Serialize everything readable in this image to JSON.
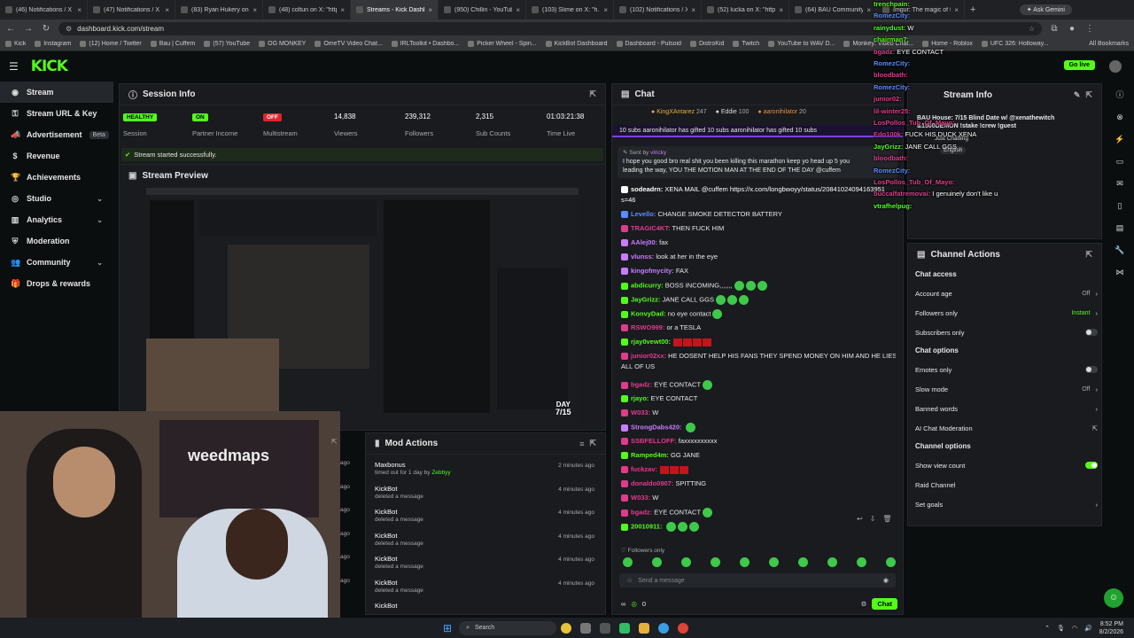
{
  "browser": {
    "tabs": [
      {
        "title": "(46) Notifications / X",
        "active": false
      },
      {
        "title": "(47) Notifications / X",
        "active": false
      },
      {
        "title": "(83) Ryan Hukery on X",
        "active": false
      },
      {
        "title": "(48) coltun on X: \"http...",
        "active": false
      },
      {
        "title": "Streams - Kick Dashboa...",
        "active": true
      },
      {
        "title": "(950) Chillin - YouTube",
        "active": false
      },
      {
        "title": "(103) Slime on X: \"h...",
        "active": false
      },
      {
        "title": "(102) Notifications / X",
        "active": false
      },
      {
        "title": "(52) lucka on X: \"http...",
        "active": false
      },
      {
        "title": "(64) BAU Community",
        "active": false
      },
      {
        "title": "Imgur: The magic of th...",
        "active": false
      }
    ],
    "ask_gemini": "Ask Gemini",
    "url": "dashboard.kick.com/stream",
    "bookmarks": [
      "Kick",
      "Instagram",
      "(12) Home / Twitter",
      "Bau | Cuffem",
      "(57) YouTube",
      "OG MONKEY",
      "OmeTV Video Chat...",
      "IRLToolkit • Dashbo...",
      "Picker Wheel - Spin...",
      "KickBot Dashboard",
      "Dashboard - Pulsoid",
      "DistroKid",
      "Twitch",
      "YouTube to WAV D...",
      "Monkey: Video Chat...",
      "Home - Roblox",
      "UFC 326: Holloway..."
    ],
    "all_bookmarks": "All Bookmarks"
  },
  "header": {
    "logo": "KICK",
    "go_live": "Go live"
  },
  "sidebar": {
    "items": [
      {
        "label": "Stream",
        "icon": "broadcast-icon",
        "active": true,
        "chevron": false
      },
      {
        "label": "Stream URL & Key",
        "icon": "key-icon",
        "active": false,
        "chevron": false
      },
      {
        "label": "Advertisement",
        "icon": "megaphone-icon",
        "active": false,
        "chevron": false,
        "badge": "Beta"
      },
      {
        "label": "Revenue",
        "icon": "dollar-icon",
        "active": false,
        "chevron": false
      },
      {
        "label": "Achievements",
        "icon": "trophy-icon",
        "active": false,
        "chevron": false
      },
      {
        "label": "Studio",
        "icon": "studio-icon",
        "active": false,
        "chevron": true
      },
      {
        "label": "Analytics",
        "icon": "chart-icon",
        "active": false,
        "chevron": true
      },
      {
        "label": "Moderation",
        "icon": "shield-icon",
        "active": false,
        "chevron": false
      },
      {
        "label": "Community",
        "icon": "people-icon",
        "active": false,
        "chevron": true
      },
      {
        "label": "Drops & rewards",
        "icon": "gift-icon",
        "active": false,
        "chevron": false
      }
    ]
  },
  "session": {
    "title": "Session Info",
    "stats": [
      {
        "value": "HEALTHY",
        "label": "Session",
        "pill": "#53fc18"
      },
      {
        "value": "ON",
        "label": "Partner Income",
        "pill": "#53fc18"
      },
      {
        "value": "OFF",
        "label": "Multistream",
        "pill": "#e0242b"
      },
      {
        "value": "14,838",
        "label": "Viewers"
      },
      {
        "value": "239,312",
        "label": "Followers"
      },
      {
        "value": "2,315",
        "label": "Sub Counts"
      },
      {
        "value": "01:03:21:38",
        "label": "Time Live"
      }
    ],
    "status": "Stream started successfully."
  },
  "preview": {
    "title": "Stream Preview",
    "day_label": "DAY",
    "day_value": "7/15"
  },
  "mod": {
    "title": "Mod Actions",
    "rows": [
      {
        "name": "Maxbonus",
        "desc": "timed out for 1 day by",
        "by": "Zebbyy",
        "time": "2 minutes ago"
      },
      {
        "name": "KickBot",
        "desc": "deleted a message",
        "time": "4 minutes ago"
      },
      {
        "name": "KickBot",
        "desc": "deleted a message",
        "time": "4 minutes ago"
      },
      {
        "name": "KickBot",
        "desc": "deleted a message",
        "time": "4 minutes ago"
      },
      {
        "name": "KickBot",
        "desc": "deleted a message",
        "time": "4 minutes ago"
      },
      {
        "name": "KickBot",
        "desc": "deleted a message",
        "time": "4 minutes ago"
      },
      {
        "name": "KickBot",
        "desc": "",
        "time": ""
      }
    ],
    "left_times": [
      "ago",
      "ago",
      "ago",
      "ago",
      "ago",
      "ago"
    ]
  },
  "chat": {
    "title": "Chat",
    "top_gifters": [
      {
        "name": "KingXAntarez",
        "count": "247"
      },
      {
        "name": "Eddie",
        "count": "100"
      },
      {
        "name": "aaronihilator",
        "count": "20"
      }
    ],
    "gift_banner": "10 subs    aaronihilator has gifted 10 subs    aaronihilator has gifted 10 subs",
    "pinned_sender": "Sent by",
    "pinned_user": "vlricky",
    "pinned_text_1": "I hope you good bro real shit you been killing this marathon keep yo head up 5 you",
    "pinned_text_2": "leading the way, YOU THE MOTION MAN AT THE END OF THE DAY @cuffem",
    "messages": [
      {
        "user": "sodeadrn:",
        "text": "XENA MAIL @cuffem https://x.com/longbwoyy/status/20841024094163951",
        "color": "#ffffff"
      },
      {
        "user": "",
        "text": "s=46",
        "color": "#ffffff"
      },
      {
        "user": "Levello:",
        "text": "CHANGE SMOKE DETECTOR BATTERY",
        "color": "#5b8cff"
      },
      {
        "user": "TRAGIC4KT:",
        "text": "THEN FUCK HIM",
        "color": "#e03b8c"
      },
      {
        "user": "AAlej00:",
        "text": "fax",
        "color": "#c97cff"
      },
      {
        "user": "vlunss:",
        "text": "look at her in the eye",
        "color": "#c97cff"
      },
      {
        "user": "kingofmycity:",
        "text": "FAX",
        "color": "#c97cff"
      },
      {
        "user": "abdicurry:",
        "text": "BOSS INCOMING,,,,,,,",
        "color": "#53fc18"
      },
      {
        "user": "JayGrizz:",
        "text": "JANE CALL GGS",
        "color": "#53fc18"
      },
      {
        "user": "KonvyDad:",
        "text": "no eye contact",
        "color": "#53fc18"
      },
      {
        "user": "RSWO999:",
        "text": "or a TESLA",
        "color": "#e03b8c"
      },
      {
        "user": "rjay0vewt00:",
        "text": "",
        "color": "#53fc18"
      },
      {
        "user": "junior02xx:",
        "text": "HE DOSENT HELP HIS FANS THEY SPEND MONEY ON HIM AND HE LIES TO",
        "color": "#e03b8c"
      },
      {
        "user": "",
        "text": "ALL OF US",
        "color": "#ffffff"
      },
      {
        "user": "bgadz:",
        "text": "EYE CONTACT",
        "color": "#e03b8c"
      },
      {
        "user": "rjayo:",
        "text": "EYE CONTACT",
        "color": "#53fc18"
      },
      {
        "user": "W033:",
        "text": "W",
        "color": "#e03b8c"
      },
      {
        "user": "StrongDabs420:",
        "text": "",
        "color": "#c97cff"
      },
      {
        "user": "SSBFELLOFF:",
        "text": "faxxxxxxxxxx",
        "color": "#e03b8c"
      },
      {
        "user": "Ramped4m:",
        "text": "GG JANE",
        "color": "#53fc18"
      },
      {
        "user": "fuckzav:",
        "text": "",
        "color": "#e03b8c"
      },
      {
        "user": "donaldo0907:",
        "text": "SPITTING",
        "color": "#e03b8c"
      },
      {
        "user": "W033:",
        "text": "W",
        "color": "#e03b8c"
      },
      {
        "user": "bgadz:",
        "text": "EYE CONTACT",
        "color": "#e03b8c"
      },
      {
        "user": "20010911:",
        "text": "",
        "color": "#53fc18"
      }
    ],
    "followers_only": "Followers only",
    "placeholder": "Send a message",
    "count": "0",
    "send": "Chat"
  },
  "stream_info": {
    "title": "Stream Info",
    "category": "Just Chatting",
    "language": "English"
  },
  "overlay_chat": [
    {
      "user": "trenchpain:",
      "text": "",
      "color": "#53fc18"
    },
    {
      "user": "RomezCity:",
      "text": "",
      "color": "#5b8cff"
    },
    {
      "user": "rainydust:",
      "text": "W",
      "color": "#53fc18"
    },
    {
      "user": "chairman7:",
      "text": "",
      "color": "#53fc18"
    },
    {
      "user": "bgadz:",
      "text": "EYE CONTACT",
      "color": "#e03b8c"
    },
    {
      "user": "RomezCity:",
      "text": "",
      "color": "#5b8cff"
    },
    {
      "user": "bloodbath:",
      "text": "",
      "color": "#e03b8c"
    },
    {
      "user": "RomezCity:",
      "text": "",
      "color": "#5b8cff"
    },
    {
      "user": "junior02:",
      "text": "",
      "color": "#e03b8c"
    },
    {
      "user": "lil-winter25:",
      "text": "",
      "color": "#e03b8c"
    },
    {
      "user": "LosPollos_Tub_Of_Mayo:",
      "text": "",
      "color": "#e03b8c"
    },
    {
      "user": "Edo100k:",
      "text": "FUCK HIS DUCK XENA",
      "color": "#e03b8c"
    },
    {
      "user": "JayGrizz:",
      "text": "JANE CALL GGS",
      "color": "#53fc18"
    },
    {
      "user": "bloodbath:",
      "text": "",
      "color": "#e03b8c"
    },
    {
      "user": "RomezCity:",
      "text": "",
      "color": "#5b8cff"
    },
    {
      "user": "LosPollos_Tub_Of_Mayo:",
      "text": "",
      "color": "#e03b8c"
    },
    {
      "user": "buccalfatremovai:",
      "text": "I genuinely don't like u",
      "color": "#e03b8c"
    },
    {
      "user": "vtrafhelpug:",
      "text": "",
      "color": "#53fc18"
    }
  ],
  "overlay_title": "BAU House: 7/15 Blind Date w/ @xenathewitch",
  "overlay_subtitle": "&1500DEMON !stake !crew !guest",
  "channel_actions": {
    "title": "Channel Actions",
    "sections": [
      {
        "title": "Chat access",
        "rows": [
          {
            "label": "Account age",
            "value": "Off",
            "control": "chevron"
          },
          {
            "label": "Followers only",
            "value": "Instant",
            "control": "chevron"
          },
          {
            "label": "Subscribers only",
            "value": "",
            "control": "toggle-off"
          }
        ]
      },
      {
        "title": "Chat options",
        "rows": [
          {
            "label": "Emotes only",
            "value": "",
            "control": "toggle-off"
          },
          {
            "label": "Slow mode",
            "value": "Off",
            "control": "chevron"
          },
          {
            "label": "Banned words",
            "value": "",
            "control": "chevron"
          },
          {
            "label": "AI Chat Moderation",
            "value": "",
            "control": "external"
          }
        ]
      },
      {
        "title": "Channel options",
        "rows": [
          {
            "label": "Show view count",
            "value": "",
            "control": "toggle-on"
          },
          {
            "label": "Raid Channel",
            "value": "",
            "control": "none"
          },
          {
            "label": "Set goals",
            "value": "",
            "control": "chevron"
          }
        ]
      }
    ]
  },
  "taskbar": {
    "search": "Search",
    "time": "8:52 PM",
    "date": "8/2/2026"
  },
  "colors": {
    "brand": "#53fc18",
    "bg": "#0b0e0f",
    "panel": "#191b1f",
    "danger": "#e0242b"
  }
}
